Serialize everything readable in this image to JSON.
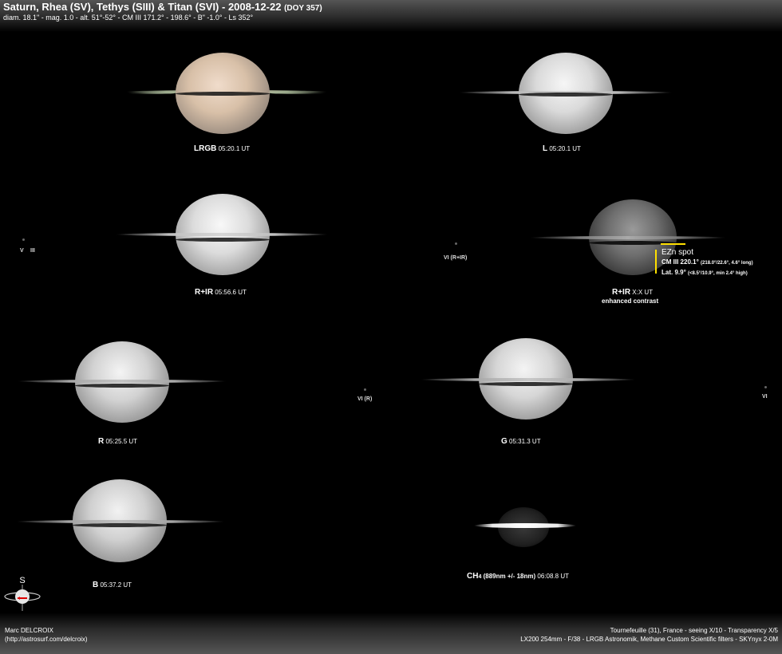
{
  "header": {
    "title": "Saturn, Rhea (SV), Tethys (SIII) & Titan (SVI) - 2008-12-22",
    "doy": "(DOY 357)",
    "subtitle": "diam. 18.1\" - mag. 1.0 - alt. 51°-52° - CM III 171.2° - 198.6° - B\" -1.0° - Ls 352°"
  },
  "panels": {
    "lrgb": {
      "filter": "LRGB",
      "time": "05:20.1 UT"
    },
    "l": {
      "filter": "L",
      "time": "05:20.1 UT"
    },
    "rir": {
      "filter": "R+IR",
      "time": "05:56.6 UT"
    },
    "rir_enh": {
      "filter": "R+IR",
      "time": "X:X UT",
      "note": "enhanced contrast"
    },
    "r": {
      "filter": "R",
      "time": "05:25.5 UT"
    },
    "g": {
      "filter": "G",
      "time": "05:31.3 UT"
    },
    "b": {
      "filter": "B",
      "time": "05:37.2 UT"
    },
    "ch4": {
      "filter_main": "CH",
      "filter_sub": "4",
      "filter_extra": "(889nm +/- 18nm)",
      "time": "06:08.8 UT"
    }
  },
  "moons": {
    "v": "V",
    "iii": "III",
    "vi_rir": "VI (R+IR)",
    "vi_r": "VI (R)",
    "vi": "VI"
  },
  "spot": {
    "title": "EZn spot",
    "cm_main": "CM III 220.1°",
    "cm_detail": "(218.0°/22.6°, 4.6° long)",
    "lat_main": "Lat. 9.9°",
    "lat_detail": "(<8.5°/10.9°, min 2.4° high)",
    "marker_color": "#ffe000"
  },
  "orientation": {
    "label": "S",
    "icon": "saturn-orientation-icon"
  },
  "footer": {
    "author": "Marc DELCROIX",
    "url": "(http://astrosurf.com/delcroix)",
    "location": "Tournefeuille (31), France - seeing X/10 - Transparency X/5",
    "equipment": "LX200 254mm - F/38 - LRGB Astronomik, Methane Custom Scientific filters - SKYnyx 2-0M"
  }
}
